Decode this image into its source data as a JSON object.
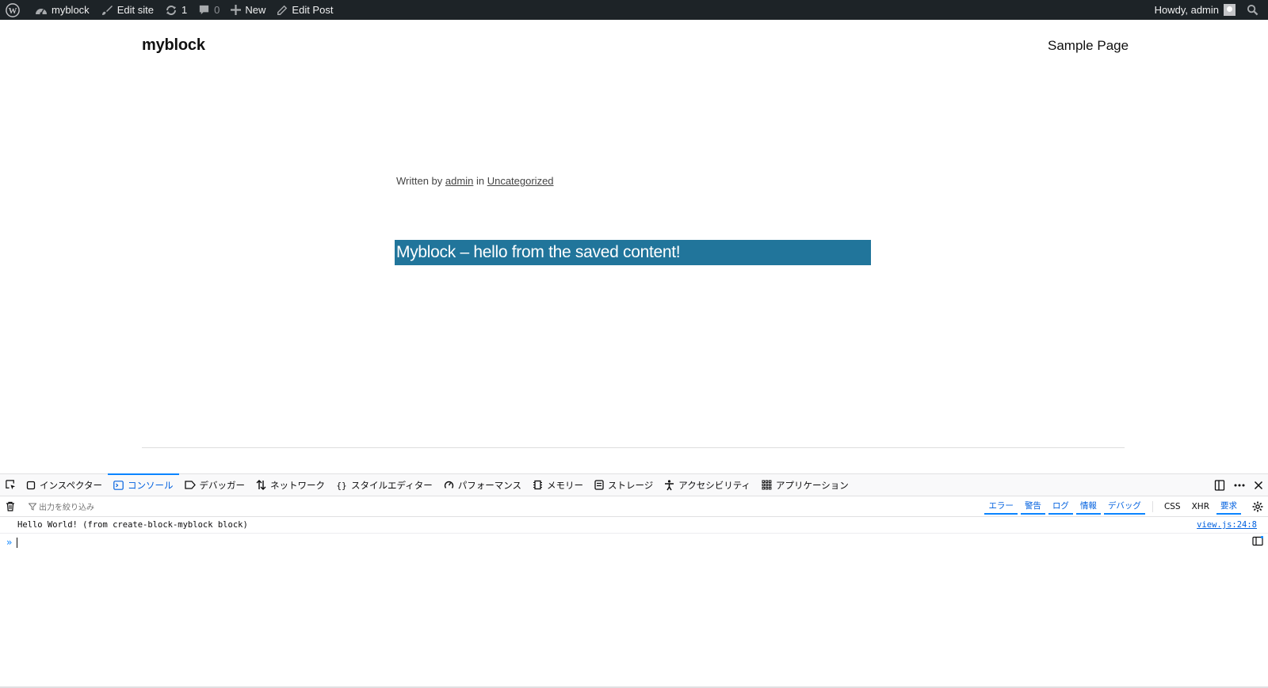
{
  "adminbar": {
    "site_name": "myblock",
    "edit_site": "Edit site",
    "updates_count": "1",
    "comments_count": "0",
    "new_label": "New",
    "edit_post": "Edit Post",
    "howdy": "Howdy, admin"
  },
  "site": {
    "title": "myblock",
    "nav_item": "Sample Page"
  },
  "post": {
    "meta_written_by": "Written by",
    "meta_author": "admin",
    "meta_in": "in",
    "meta_category": "Uncategorized",
    "block_text": "Myblock – hello from the saved content!"
  },
  "devtools": {
    "tabs": [
      {
        "label": "インスペクター",
        "icon": "inspector-icon"
      },
      {
        "label": "コンソール",
        "icon": "console-icon",
        "selected": true
      },
      {
        "label": "デバッガー",
        "icon": "debugger-icon"
      },
      {
        "label": "ネットワーク",
        "icon": "network-icon"
      },
      {
        "label": "スタイルエディター",
        "icon": "style-editor-icon"
      },
      {
        "label": "パフォーマンス",
        "icon": "performance-icon"
      },
      {
        "label": "メモリー",
        "icon": "memory-icon"
      },
      {
        "label": "ストレージ",
        "icon": "storage-icon"
      },
      {
        "label": "アクセシビリティ",
        "icon": "accessibility-icon"
      },
      {
        "label": "アプリケーション",
        "icon": "application-icon"
      }
    ],
    "filter_placeholder": "出力を絞り込み",
    "levels": [
      "エラー",
      "警告",
      "ログ",
      "情報",
      "デバッグ"
    ],
    "extra_filters": [
      "CSS",
      "XHR",
      "要求"
    ],
    "message": {
      "text": "Hello World! (from create-block-myblock block)",
      "source": "view.js:24:8"
    },
    "prompt_symbol": "»"
  },
  "colors": {
    "adminbar_bg": "#1d2327",
    "block_bg": "#21759b",
    "devtools_accent": "#0a84ff"
  }
}
